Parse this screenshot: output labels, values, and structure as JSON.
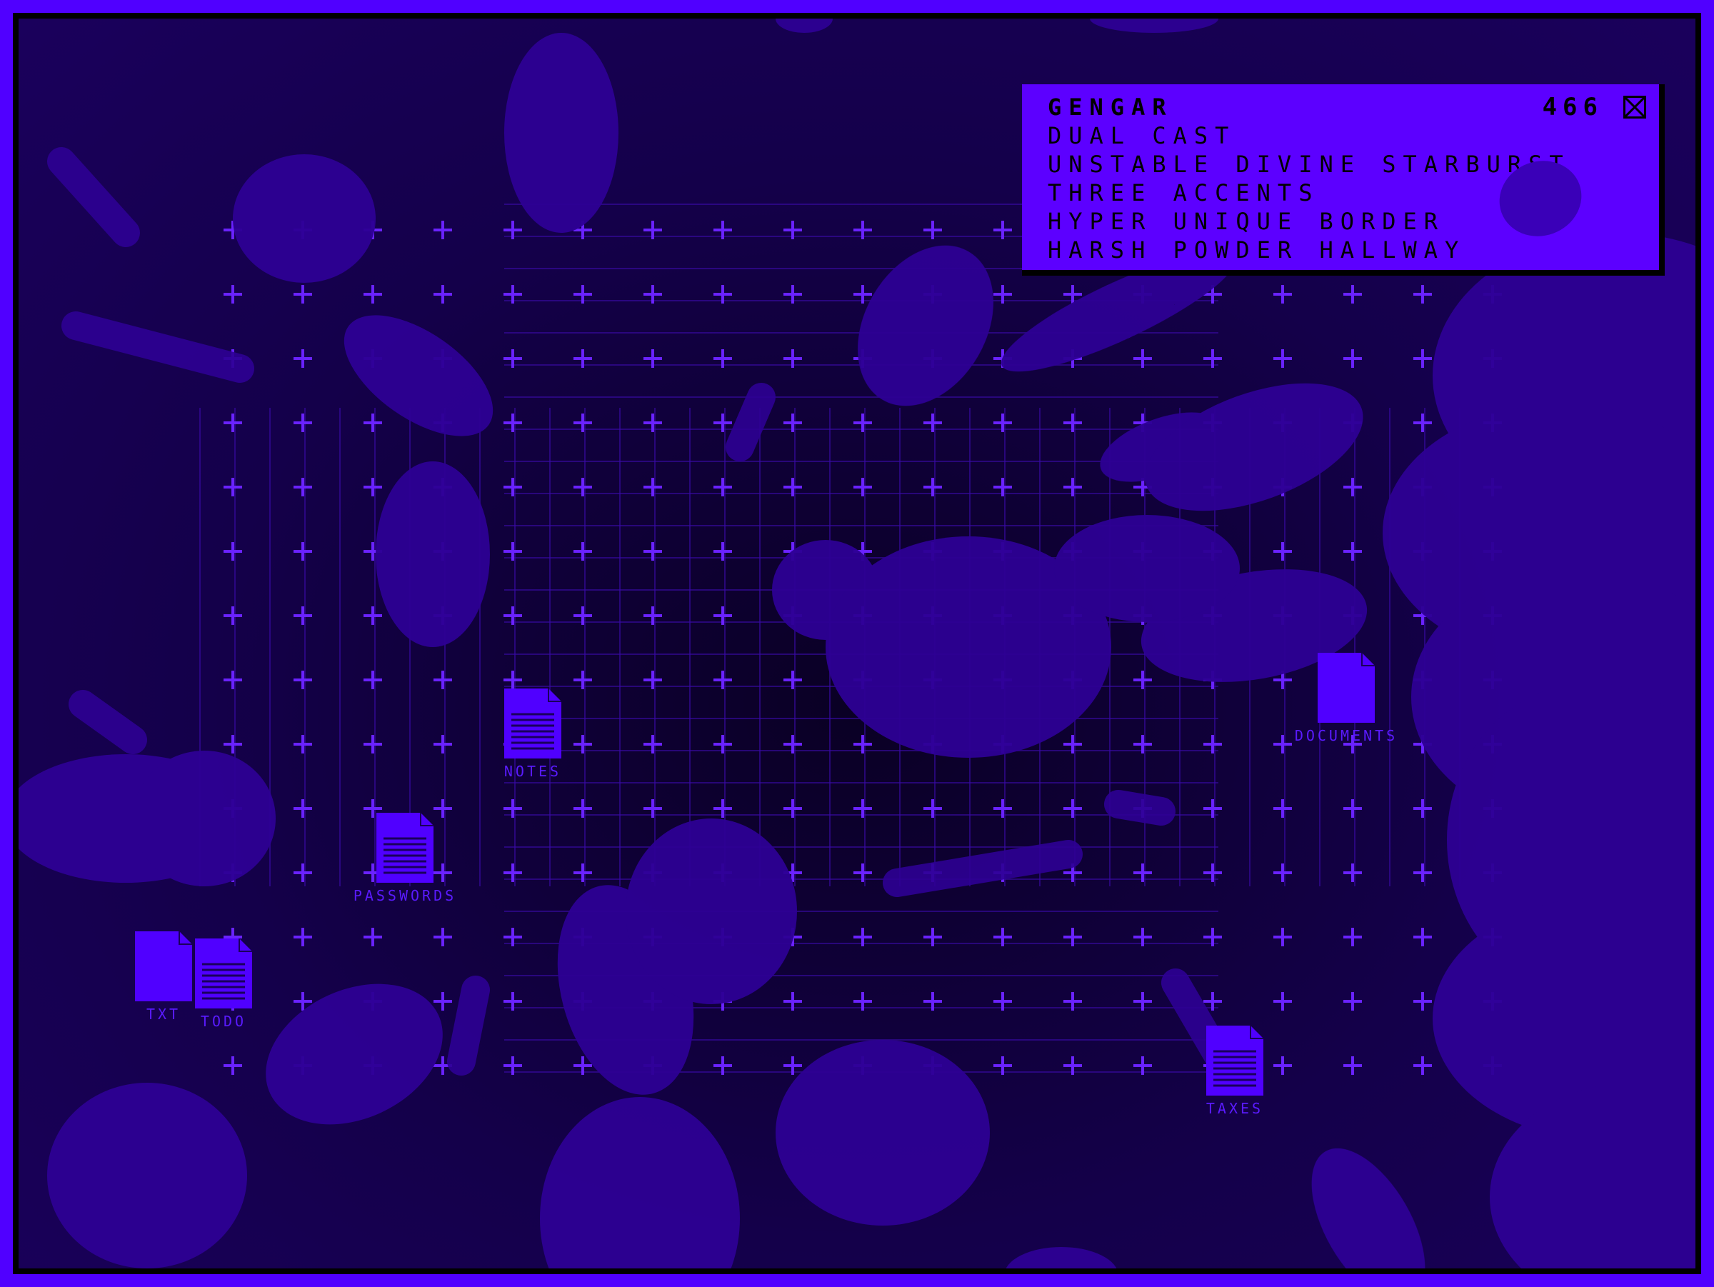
{
  "window": {
    "title": "GENGAR",
    "count": "466",
    "close_icon": "close-x-icon"
  },
  "panel_lines": [
    "DUAL CAST",
    "UNSTABLE DIVINE STARBURST",
    "THREE ACCENTS",
    "HYPER UNIQUE BORDER",
    "HARSH POWDER HALLWAY"
  ],
  "desktop_icons": [
    {
      "label": "NOTES",
      "icon": "document-icon"
    },
    {
      "label": "PASSWORDS",
      "icon": "document-icon"
    },
    {
      "label": "DOCUMENTS",
      "icon": "document-icon"
    },
    {
      "label": "TAXES",
      "icon": "document-icon"
    },
    {
      "label": "TXT",
      "icon": "document-icon"
    },
    {
      "label": "TODO",
      "icon": "document-icon"
    }
  ],
  "colors": {
    "accent": "#5000ff",
    "panel": "#5c00ff",
    "blob": "#2e0094",
    "background": "#0a0024"
  }
}
